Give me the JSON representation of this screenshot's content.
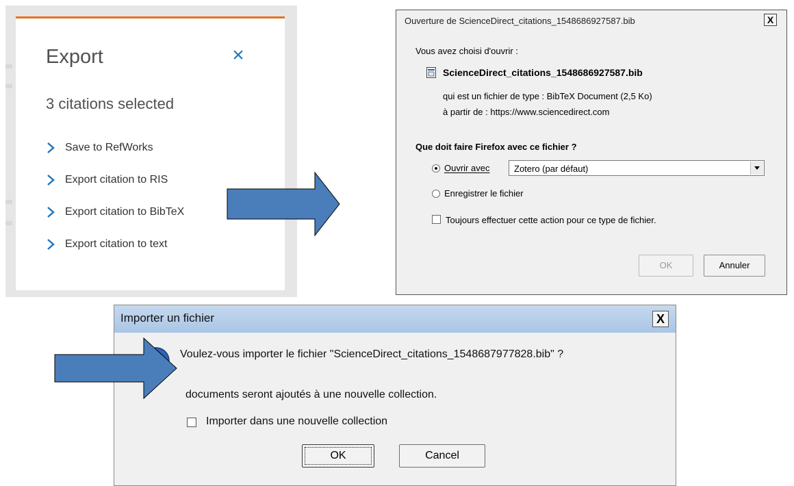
{
  "top_cut_text": "                   ",
  "export": {
    "title": "Export",
    "close_glyph": "×",
    "subtitle": "3 citations selected",
    "items": [
      {
        "label": "Save to RefWorks"
      },
      {
        "label": "Export citation to RIS"
      },
      {
        "label": "Export citation to BibTeX"
      },
      {
        "label": "Export citation to text"
      }
    ],
    "accent_color": "#e9711c",
    "link_color": "#1f74b8"
  },
  "firefox_dialog": {
    "title": "Ouverture de ScienceDirect_citations_1548686927587.bib",
    "close_glyph": "X",
    "intro": "Vous avez choisi d'ouvrir :",
    "filename": "ScienceDirect_citations_1548686927587.bib",
    "type_line": "qui est un fichier de type : BibTeX Document (2,5 Ko)",
    "from_line": "à partir de : https://www.sciencedirect.com",
    "question": "Que doit faire Firefox avec ce fichier ?",
    "open_with_label": "Ouvrir avec",
    "open_with_value": "Zotero (par défaut)",
    "save_label": "Enregistrer le fichier",
    "always_label": "Toujours effectuer cette action pour ce type de fichier.",
    "ok_label": "OK",
    "cancel_label": "Annuler",
    "selected_option": "open_with"
  },
  "zotero_dialog": {
    "title": "Importer un fichier",
    "close_glyph": "X",
    "question": "Voulez-vous importer le fichier \"ScienceDirect_citations_1548687977828.bib\" ?",
    "info": "documents seront ajoutés à une nouvelle collection.",
    "checkbox_label": "Importer dans une nouvelle collection",
    "checkbox_checked": false,
    "ok_label": "OK",
    "cancel_label": "Cancel"
  },
  "colors": {
    "arrow_fill": "#4a7ebb",
    "arrow_stroke": "#000000"
  }
}
